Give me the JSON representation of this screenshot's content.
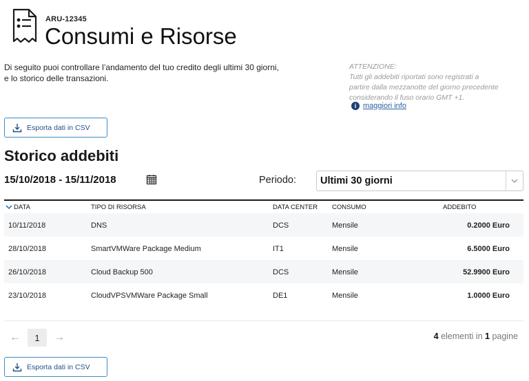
{
  "header": {
    "code": "ARU-12345",
    "title": "Consumi e Risorse"
  },
  "intro": {
    "line1": "Di seguito puoi controllare l’andamento del tuo credito degli ultimi 30 giorni,",
    "line2": "e lo storico delle transazioni."
  },
  "attention": {
    "title": "ATTENZIONE:",
    "line1": "Tutti gli addebiti riportati sono registrati a",
    "line2": "partire dalla mezzanotte del giorno precedente",
    "line3": "considerando il fuso orario GMT +1.",
    "link": "maggiori info"
  },
  "export": {
    "label": "Esporta dati in CSV"
  },
  "history": {
    "title": "Storico addebiti",
    "date_range": "15/10/2018 - 15/11/2018",
    "period_label": "Periodo:",
    "period_value": "Ultimi 30 giorni"
  },
  "table": {
    "columns": {
      "date": "DATA",
      "type": "TIPO DI RISORSA",
      "datacenter": "DATA CENTER",
      "consumption": "CONSUMO",
      "charge": "ADDEBITO"
    },
    "rows": [
      {
        "date": "10/11/2018",
        "type": "DNS",
        "datacenter": "DCS",
        "consumption": "Mensile",
        "charge": "0.2000 Euro"
      },
      {
        "date": "28/10/2018",
        "type": "SmartVMWare Package Medium",
        "datacenter": "IT1",
        "consumption": "Mensile",
        "charge": "6.5000 Euro"
      },
      {
        "date": "26/10/2018",
        "type": "Cloud Backup 500",
        "datacenter": "DCS",
        "consumption": "Mensile",
        "charge": "52.9900 Euro"
      },
      {
        "date": "23/10/2018",
        "type": "CloudVPSVMWare Package Small",
        "datacenter": "DE1",
        "consumption": "Mensile",
        "charge": "1.0000 Euro"
      }
    ]
  },
  "pagination": {
    "prev": "←",
    "current": "1",
    "next": "→",
    "count": "4",
    "elements_label": "elementi in",
    "pages": "1",
    "pages_label": "pagine"
  },
  "colors": {
    "accent": "#3a8bc4",
    "link": "#2d5fa0",
    "muted": "#9a9a9a"
  },
  "icons": {
    "doc": "receipt-document-icon",
    "download": "download-icon",
    "calendar": "calendar-icon",
    "info": "info-icon",
    "caret": "chevron-down-icon",
    "sort": "sort-chevron-icon"
  }
}
